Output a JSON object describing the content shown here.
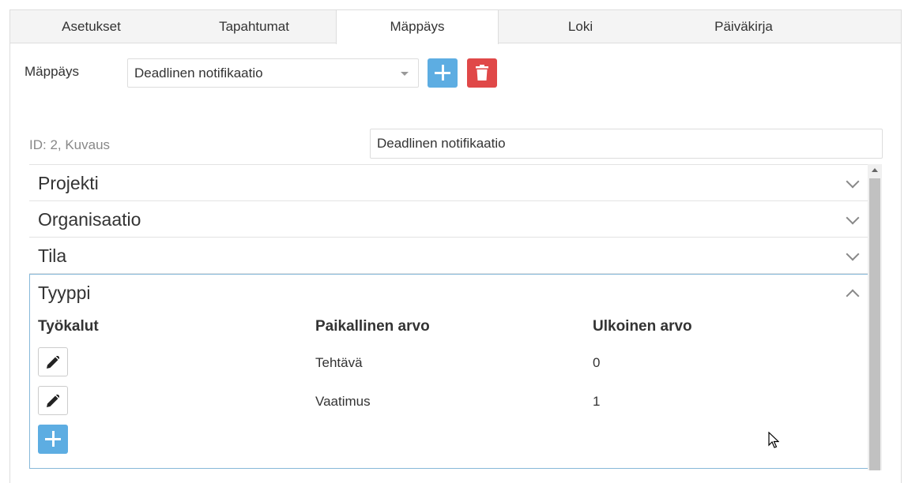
{
  "tabs": [
    {
      "label": "Asetukset",
      "active": false
    },
    {
      "label": "Tapahtumat",
      "active": false
    },
    {
      "label": "Mäppäys",
      "active": true
    },
    {
      "label": "Loki",
      "active": false
    },
    {
      "label": "Päiväkirja",
      "active": false
    }
  ],
  "mapping": {
    "label": "Mäppäys",
    "selected": "Deadlinen notifikaatio"
  },
  "description": {
    "label": "ID: 2, Kuvaus",
    "value": "Deadlinen notifikaatio"
  },
  "sections": [
    {
      "title": "Projekti"
    },
    {
      "title": "Organisaatio"
    },
    {
      "title": "Tila"
    }
  ],
  "open_section": {
    "title": "Tyyppi",
    "columns": [
      "Työkalut",
      "Paikallinen arvo",
      "Ulkoinen arvo"
    ],
    "rows": [
      {
        "local": "Tehtävä",
        "external": "0"
      },
      {
        "local": "Vaatimus",
        "external": "1"
      }
    ]
  },
  "colors": {
    "primary": "#5dade2",
    "danger": "#e04848",
    "open_border": "#87b8d9"
  },
  "icons": {
    "add": "plus-icon",
    "delete": "trash-icon",
    "edit": "pencil-icon",
    "collapse": "chevron-down-icon",
    "expand": "chevron-up-icon"
  }
}
